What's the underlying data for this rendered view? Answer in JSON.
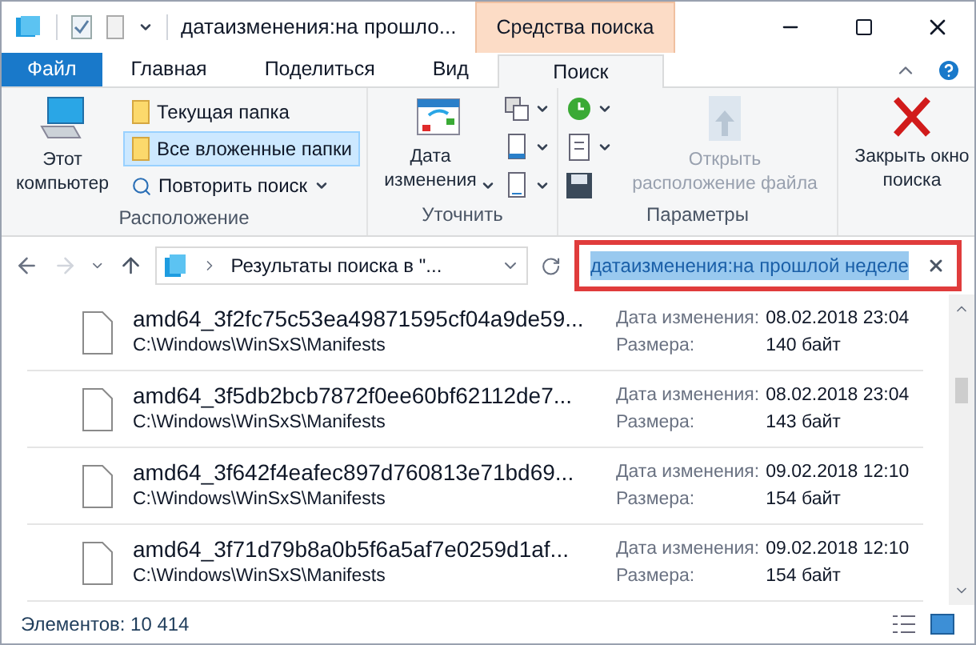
{
  "window": {
    "title": "датаизменения:на прошло...",
    "context_tab": "Средства поиска"
  },
  "ribbon_tabs": [
    {
      "label": "Файл",
      "kind": "file",
      "selected": false
    },
    {
      "label": "Главная",
      "kind": "tab",
      "selected": false
    },
    {
      "label": "Поделиться",
      "kind": "tab",
      "selected": false
    },
    {
      "label": "Вид",
      "kind": "tab",
      "selected": false
    },
    {
      "label": "Поиск",
      "kind": "tab",
      "selected": true
    }
  ],
  "ribbon_groups": [
    {
      "label": "Расположение",
      "big": {
        "label": "Этот компьютер",
        "disabled": false
      },
      "items": [
        {
          "label": "Текущая папка",
          "selected": false
        },
        {
          "label": "Все вложенные папки",
          "selected": true
        },
        {
          "label": "Повторить поиск",
          "selected": false
        }
      ]
    },
    {
      "label": "Уточнить",
      "big": {
        "label": "Дата изменения",
        "disabled": false
      }
    },
    {
      "label": "Параметры",
      "big": {
        "label": "Открыть расположение файла",
        "disabled": true
      }
    },
    {
      "big": {
        "label": "Закрыть окно поиска",
        "disabled": false
      }
    }
  ],
  "address": {
    "path": "Результаты поиска в \"..."
  },
  "search": {
    "value": "датаизменения:на прошлой неделе",
    "selected": true
  },
  "files": [
    {
      "name": "amd64_3f2fc75c53ea49871595cf04a9de59...",
      "path": "C:\\Windows\\WinSxS\\Manifests",
      "date_label": "Дата изменения:",
      "date": "08.02.2018 23:04",
      "size_label": "Размера:",
      "size": "140 байт"
    },
    {
      "name": "amd64_3f5db2bcb7872f0ee60bf62112de7...",
      "path": "C:\\Windows\\WinSxS\\Manifests",
      "date_label": "Дата изменения:",
      "date": "08.02.2018 23:04",
      "size_label": "Размера:",
      "size": "143 байт"
    },
    {
      "name": "amd64_3f642f4eafec897d760813e71bd69...",
      "path": "C:\\Windows\\WinSxS\\Manifests",
      "date_label": "Дата изменения:",
      "date": "09.02.2018 12:10",
      "size_label": "Размера:",
      "size": "154 байт"
    },
    {
      "name": "amd64_3f71d79b8a0b5f6a5af7e0259d1af...",
      "path": "C:\\Windows\\WinSxS\\Manifests",
      "date_label": "Дата изменения:",
      "date": "09.02.2018 12:10",
      "size_label": "Размера:",
      "size": "154 байт"
    }
  ],
  "status_bar": {
    "count": "Элементов: 10 414"
  }
}
